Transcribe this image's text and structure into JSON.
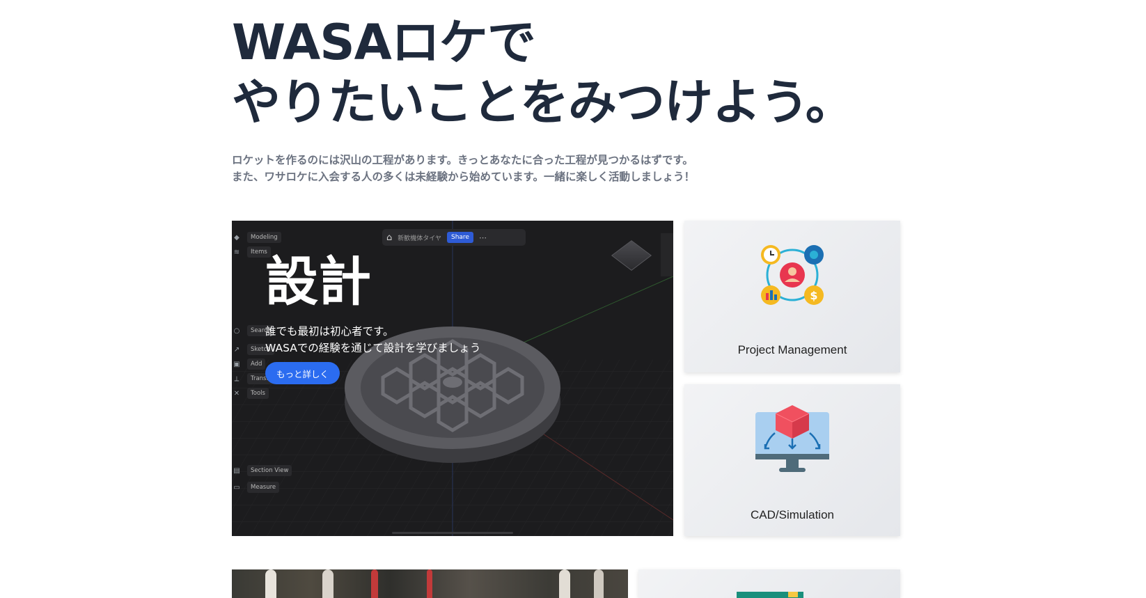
{
  "hero": {
    "title_line1": "WASAロケで",
    "title_line2": "やりたいことをみつけよう。",
    "desc_line1": "ロケットを作るのには沢山の工程があります。きっとあなたに合った工程が見つかるはずです。",
    "desc_line2": "また、ワサロケに入会する人の多くは未経験から始めています。一緒に楽しく活動しましょう！"
  },
  "design": {
    "title": "設計",
    "desc_line1": "誰でも最初は初心者です。",
    "desc_line2": "WASAでの経験を通じて設計を学びましょう",
    "button": "もっと詳しく",
    "cad_ui": {
      "doc_name": "新歓機体タイヤ",
      "share": "Share",
      "tools": [
        "Modeling",
        "Items",
        "Search",
        "Sketch",
        "Add",
        "Transform",
        "Tools",
        "Section View",
        "Measure"
      ]
    }
  },
  "cards": {
    "project_management": "Project Management",
    "cad_simulation": "CAD/Simulation"
  },
  "colors": {
    "heading": "#1f2a3c",
    "body_text": "#6b7280",
    "button": "#2b6cf0",
    "card_bg": "#eceef1"
  },
  "icons": [
    "home-icon",
    "more-icon",
    "project-management-icon",
    "cad-simulation-icon"
  ]
}
